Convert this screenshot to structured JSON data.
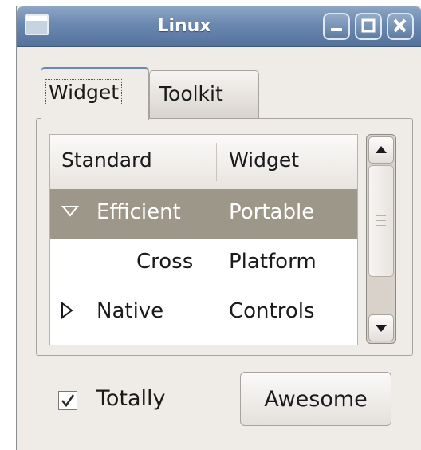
{
  "window": {
    "title": "Linux",
    "controls": {
      "minimize": "–",
      "maximize": "□",
      "close": "×"
    }
  },
  "tabs": [
    {
      "label": "Widget",
      "selected": true
    },
    {
      "label": "Toolkit",
      "selected": false
    }
  ],
  "tree": {
    "columns": [
      "Standard",
      "Widget"
    ],
    "rows": [
      {
        "col1": "Efficient",
        "col2": "Portable",
        "expander": "expanded",
        "selected": true
      },
      {
        "col1": "Cross",
        "col2": "Platform",
        "expander": "none",
        "selected": false
      },
      {
        "col1": "Native",
        "col2": "Controls",
        "expander": "collapsed",
        "selected": false
      }
    ]
  },
  "checkbox": {
    "label": "Totally",
    "checked": true
  },
  "button": {
    "label": "Awesome"
  },
  "colors": {
    "titlebar": "#6a88b0",
    "selection": "#9d9789",
    "window_bg": "#efebe7"
  }
}
